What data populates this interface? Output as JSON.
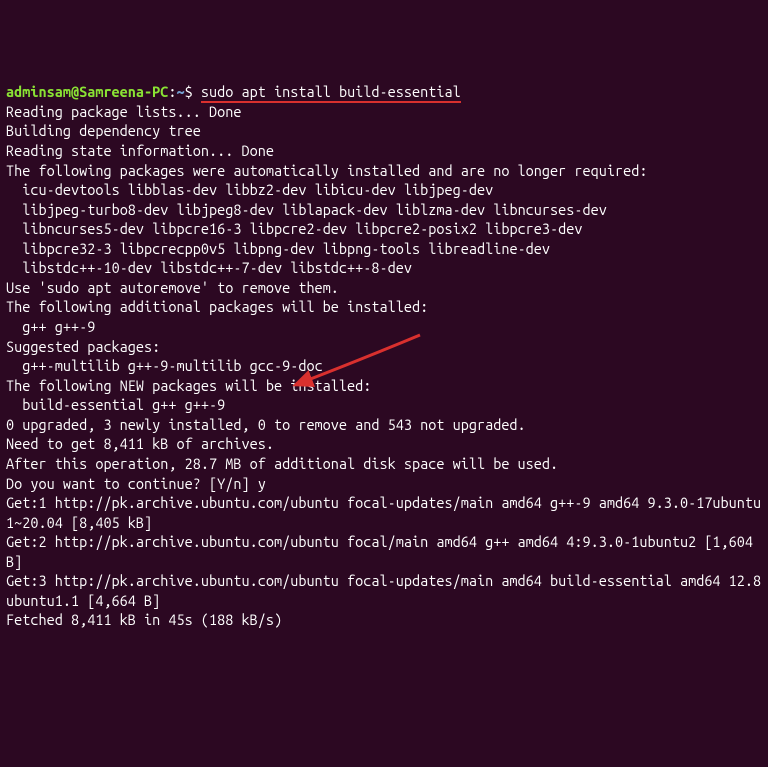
{
  "prompt": {
    "user_host": "adminsam@Samreena-PC",
    "separator": ":",
    "cwd": "~",
    "symbol": "$",
    "command": "sudo apt install build-essential"
  },
  "lines": {
    "l0": "Reading package lists... Done",
    "l1": "Building dependency tree",
    "l2": "Reading state information... Done",
    "l3": "The following packages were automatically installed and are no longer required:",
    "l4": "  icu-devtools libblas-dev libbz2-dev libicu-dev libjpeg-dev",
    "l5": "  libjpeg-turbo8-dev libjpeg8-dev liblapack-dev liblzma-dev libncurses-dev",
    "l6": "  libncurses5-dev libpcre16-3 libpcre2-dev libpcre2-posix2 libpcre3-dev",
    "l7": "  libpcre32-3 libpcrecpp0v5 libpng-dev libpng-tools libreadline-dev",
    "l8": "  libstdc++-10-dev libstdc++-7-dev libstdc++-8-dev",
    "l9": "Use 'sudo apt autoremove' to remove them.",
    "l10": "The following additional packages will be installed:",
    "l11": "  g++ g++-9",
    "l12": "Suggested packages:",
    "l13": "  g++-multilib g++-9-multilib gcc-9-doc",
    "l14": "The following NEW packages will be installed:",
    "l15": "  build-essential g++ g++-9",
    "l16": "0 upgraded, 3 newly installed, 0 to remove and 543 not upgraded.",
    "l17": "Need to get 8,411 kB of archives.",
    "l18": "After this operation, 28.7 MB of additional disk space will be used.",
    "l19": "Do you want to continue? [Y/n] y",
    "l20": "Get:1 http://pk.archive.ubuntu.com/ubuntu focal-updates/main amd64 g++-9 amd64 9.3.0-17ubuntu1~20.04 [8,405 kB]",
    "l21": "Get:2 http://pk.archive.ubuntu.com/ubuntu focal/main amd64 g++ amd64 4:9.3.0-1ubuntu2 [1,604 B]",
    "l22": "Get:3 http://pk.archive.ubuntu.com/ubuntu focal-updates/main amd64 build-essential amd64 12.8ubuntu1.1 [4,664 B]",
    "l23": "Fetched 8,411 kB in 45s (188 kB/s)"
  },
  "annotation": {
    "arrow_color": "#d9302e"
  }
}
